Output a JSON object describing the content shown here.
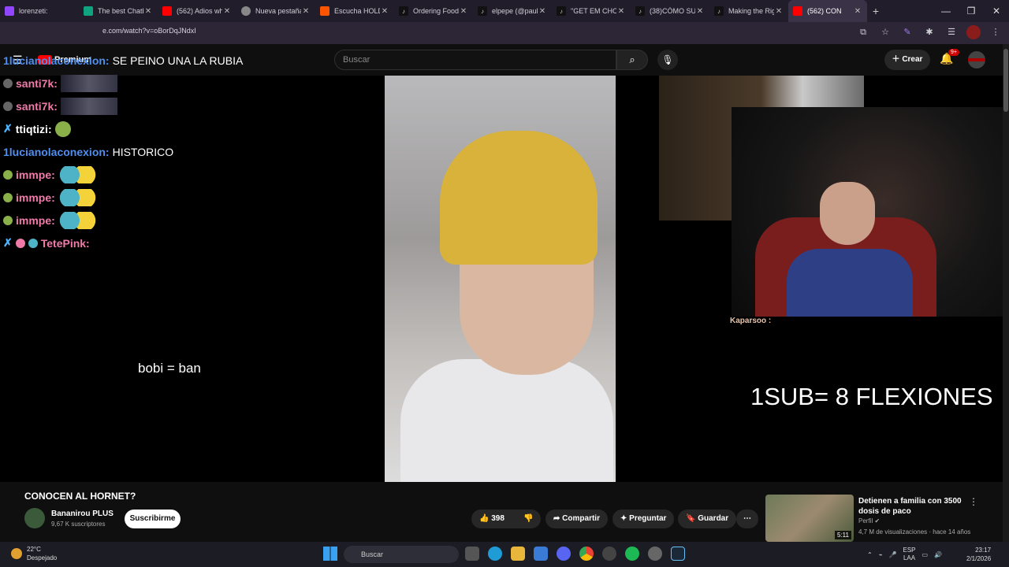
{
  "browser": {
    "tabs": [
      {
        "title": "lorenzeti:",
        "favicon_color": "#9146ff"
      },
      {
        "title": "The best Chatb",
        "favicon_color": "#10a37f"
      },
      {
        "title": "(562) Adios wh",
        "favicon_color": "#ff0000"
      },
      {
        "title": "Nueva pestaña",
        "favicon_color": "#888888"
      },
      {
        "title": "Escucha HOLDI",
        "favicon_color": "#ff5500"
      },
      {
        "title": "Ordering Food",
        "favicon_color": "#111111"
      },
      {
        "title": "elpepe (@paul",
        "favicon_color": "#111111"
      },
      {
        "title": "\"GET EM CHOP",
        "favicon_color": "#111111"
      },
      {
        "title": "(38)CÓMO SUF",
        "favicon_color": "#111111"
      },
      {
        "title": "Making the Rig",
        "favicon_color": "#111111"
      },
      {
        "title": "(562) CON",
        "favicon_color": "#ff0000"
      }
    ],
    "url": "e.com/watch?v=oBorDqJNdxI",
    "new_tab": "+"
  },
  "youtube": {
    "logo_text": "Premium",
    "search_placeholder": "Buscar",
    "create_label": "Crear",
    "notifications": "9+"
  },
  "chat": {
    "messages": [
      {
        "user": "1lucianolaconexion:",
        "text": "SE PEINO UNA LA RUBIA",
        "user_color": "#4f8ff0"
      },
      {
        "user": "santi7k:",
        "text": "",
        "user_color": "#f07aa8"
      },
      {
        "user": "santi7k:",
        "text": "",
        "user_color": "#f07aa8"
      },
      {
        "user": "ttiqtizi:",
        "text": "",
        "user_color": "#ffffff"
      },
      {
        "user": "1lucianolaconexion:",
        "text": "HISTORICO",
        "user_color": "#4f8ff0"
      },
      {
        "user": "immpe:",
        "text": "",
        "user_color": "#f07aa8"
      },
      {
        "user": "immpe:",
        "text": "",
        "user_color": "#f07aa8"
      },
      {
        "user": "immpe:",
        "text": "",
        "user_color": "#f07aa8"
      },
      {
        "user": "TetePink:",
        "text": "",
        "user_color": "#f07aa8"
      }
    ]
  },
  "overlays": {
    "text1": "bobi = ban",
    "text2": "1SUB= 8 FLEXIONES",
    "kaparsoo": "Kaparsoo :"
  },
  "video_info": {
    "title": "CONOCEN AL HORNET?",
    "channel": "Bananirou PLUS",
    "subscribers": "9,67 K suscriptores",
    "subscribe_label": "Suscribirme",
    "likes": "398",
    "share_label": "Compartir",
    "ask_label": "Preguntar",
    "save_label": "Guardar"
  },
  "recommendation": {
    "title": "Detienen a familia con 3500 dosis de paco",
    "channel": "Perfil",
    "meta": "4,7 M de visualizaciones · hace 14 años",
    "duration": "5:11"
  },
  "taskbar": {
    "temperature": "22°C",
    "weather": "Despejado",
    "search_placeholder": "Buscar",
    "lang1": "ESP",
    "lang2": "LAA",
    "time": "23:17",
    "date": "2/1/2026"
  }
}
